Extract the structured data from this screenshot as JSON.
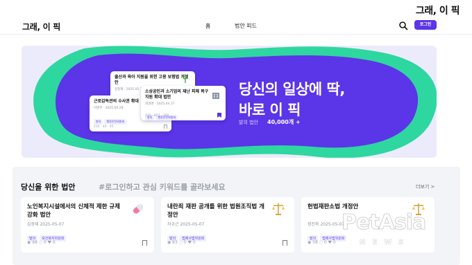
{
  "corner_title": "그래, 이 픽",
  "header": {
    "logo": "그래, 이 픽",
    "nav": [
      "홈",
      "법안 피드"
    ],
    "login_label": "로그인"
  },
  "hero": {
    "headline_line1": "당신의 일상에 딱,",
    "headline_line2": "바로 이 픽",
    "stat_label": "발의 법안",
    "stat_value": "40,000개 +",
    "colors": {
      "purple": "#5b35e8",
      "green": "#2ed7a0",
      "background": "#ecebfb"
    },
    "mini_cards": [
      {
        "title": "출산과 육아 지원을 위한 고용 보험법 개정안",
        "meta": "김정재 · 2025.05.11",
        "tags": [
          "발의",
          "환경노동위원회"
        ],
        "stats": "",
        "icon": "seedling-icon"
      },
      {
        "title": "근로감독관의 수사권 확대",
        "meta": "이병주 · 2025.04.28",
        "tags": [
          "발의",
          "행정안전위원회"
        ],
        "stats": "235 · 40 · 45",
        "icon": ""
      },
      {
        "title": "소상공인과 소기업의 재난 피해 복구 지원 확대 법안",
        "meta": "최권명 · 2025.04.17",
        "tags": [
          "발의",
          "행정안전위원회"
        ],
        "stats": "230 · 857 · 160",
        "icon": "building-icon"
      }
    ]
  },
  "section": {
    "title": "당신을 위한 법안",
    "subtitle": "#로그인하고 관심 키워드를 골라보세요",
    "more_label": "더보기 >",
    "cards": [
      {
        "title": "노인복지시설에서의 신체적 제한 규제 강화 법안",
        "meta": "김정재  2025-05-07",
        "tags": [
          "발의",
          "보건복지위원회"
        ],
        "views": "98",
        "comments": "0",
        "likes": "0",
        "icon": "pill-icon"
      },
      {
        "title": "내란죄 재판 공개를 위한 법원조직법 개정안",
        "meta": "차규근  2025-05-07",
        "tags": [
          "발의",
          "법제사법위원회"
        ],
        "views": "83",
        "comments": "0",
        "likes": "0",
        "icon": "scales-icon"
      },
      {
        "title": "헌법재판소법 개정안",
        "meta": "정진욱  2025-05-07",
        "tags": [
          "발의",
          "법제사법위원회"
        ],
        "views": "58",
        "comments": "0",
        "likes": "0",
        "icon": "scales-icon"
      }
    ]
  },
  "watermark": {
    "logo": "PetAsia",
    "sub": "NEWS"
  }
}
